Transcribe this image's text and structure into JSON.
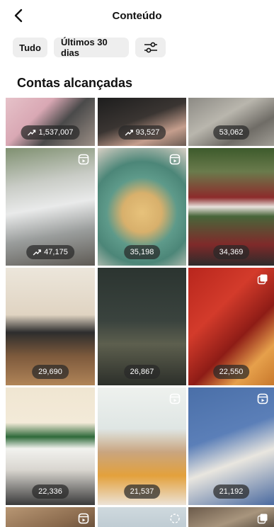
{
  "header": {
    "title": "Conteúdo"
  },
  "filters": {
    "all_label": "Tudo",
    "period_label": "Últimos 30 dias"
  },
  "section": {
    "title": "Contas alcançadas"
  },
  "posts": [
    {
      "reach": "1,537,007",
      "trend": true,
      "type": ""
    },
    {
      "reach": "93,527",
      "trend": true,
      "type": ""
    },
    {
      "reach": "53,062",
      "trend": false,
      "type": ""
    },
    {
      "reach": "47,175",
      "trend": true,
      "type": "reel"
    },
    {
      "reach": "35,198",
      "trend": false,
      "type": "reel"
    },
    {
      "reach": "34,369",
      "trend": false,
      "type": ""
    },
    {
      "reach": "29,690",
      "trend": false,
      "type": ""
    },
    {
      "reach": "26,867",
      "trend": false,
      "type": ""
    },
    {
      "reach": "22,550",
      "trend": false,
      "type": "carousel"
    },
    {
      "reach": "22,336",
      "trend": false,
      "type": ""
    },
    {
      "reach": "21,537",
      "trend": false,
      "type": "reel"
    },
    {
      "reach": "21,192",
      "trend": false,
      "type": "reel"
    },
    {
      "reach": "",
      "trend": false,
      "type": "reel"
    },
    {
      "reach": "",
      "trend": false,
      "type": "loading"
    },
    {
      "reach": "",
      "trend": false,
      "type": "carousel"
    }
  ]
}
